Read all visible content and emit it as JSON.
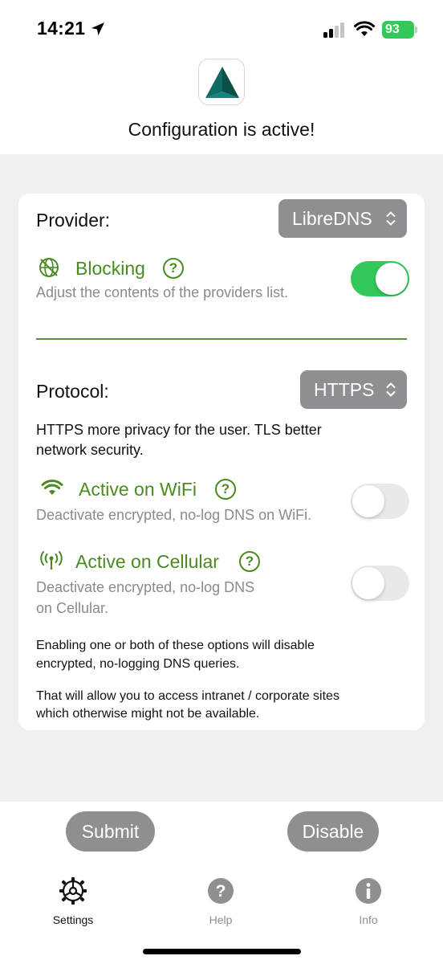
{
  "status_bar": {
    "time": "14:21",
    "battery": "93"
  },
  "header": {
    "title": "Configuration is active!"
  },
  "provider": {
    "label": "Provider:",
    "value": "LibreDNS"
  },
  "blocking": {
    "title": "Blocking",
    "help": "?",
    "description": "Adjust the contents of the providers list.",
    "enabled": true
  },
  "protocol": {
    "label": "Protocol:",
    "value": "HTTPS",
    "note": "HTTPS more privacy for the user.  TLS better network security."
  },
  "wifi": {
    "title": "Active on WiFi",
    "help": "?",
    "description": "Deactivate  encrypted, no-log DNS on WiFi.",
    "enabled": false
  },
  "cellular": {
    "title": "Active on Cellular",
    "help": "?",
    "description_line1": "Deactivate encrypted, no-log DNS",
    "description_line2": "on Cellular.",
    "enabled": false
  },
  "info": {
    "line1": "Enabling one or both of these options will disable",
    "line2": "encrypted, no-logging DNS queries.",
    "line3": "That will allow you to access intranet / corporate sites",
    "line4": "which otherwise might not be available."
  },
  "actions": {
    "submit": "Submit",
    "disable": "Disable"
  },
  "tabs": [
    {
      "label": "Settings",
      "icon": "gear-icon",
      "active": true
    },
    {
      "label": "Help",
      "icon": "question-circle-icon",
      "active": false
    },
    {
      "label": "Info",
      "icon": "info-circle-icon",
      "active": false
    }
  ],
  "colors": {
    "accent_green": "#4a8a1f",
    "toggle_on": "#34c759",
    "button_gray": "#8e8e93"
  }
}
